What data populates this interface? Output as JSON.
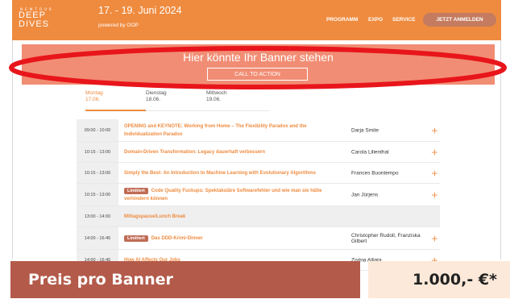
{
  "header": {
    "logo_small": "NEWTOUR",
    "logo_line1": "DEEP",
    "logo_line2": "DIVES",
    "dates": "17. - 19. Juni 2024",
    "powered": "powered by OOP",
    "nav": [
      "PROGRAMM",
      "EXPO",
      "SERVICE"
    ],
    "cta": "JETZT ANMELDEN"
  },
  "banner": {
    "title": "Hier könnte Ihr Banner stehen",
    "button": "CALL TO ACTION"
  },
  "tabs": [
    {
      "day": "Montag",
      "date": "17.06."
    },
    {
      "day": "Dienstag",
      "date": "18.06."
    },
    {
      "day": "Mittwoch",
      "date": "19.06."
    }
  ],
  "schedule": [
    {
      "time": "09:00 - 10:00",
      "badge": "",
      "title": "OPENING and KEYNOTE: Working from Home – The Flexibility Paradox and the Individualization Paradox",
      "speaker": "Darja Smite"
    },
    {
      "time": "10:15 - 13:00",
      "badge": "",
      "title": "Domain-Driven Transformation: Legacy dauerhaft verbessern",
      "speaker": "Carola Lilienthal"
    },
    {
      "time": "10:15 - 13:00",
      "badge": "",
      "title": "Simply the Best: An Introduction to Machine Learning with Evolutionary Algorithms",
      "speaker": "Frances Buontempo"
    },
    {
      "time": "10:15 - 13:00",
      "badge": "Limitiert",
      "title": "Code Quality Fuckups: Spektakuläre Softwarefehler und wie man sie hätte verhindern können",
      "speaker": "Jan Jürjens"
    },
    {
      "time": "13:00 - 14:00",
      "badge": "",
      "title": "Mittagspause/Lunch Break",
      "speaker": ""
    },
    {
      "time": "14:00 - 16:45",
      "badge": "Limitiert",
      "title": "Das DDD-Krimi-Dinner",
      "speaker": "Christopher Rudoll, Franziska Gilbert"
    },
    {
      "time": "14:00 - 16:45",
      "badge": "",
      "title": "How AI Affects Our Jobs",
      "speaker": "Zorina Alliata"
    }
  ],
  "price": {
    "label": "Preis pro Banner",
    "value": "1.000,- €*"
  },
  "colors": {
    "brand_orange": "#ef8b3f",
    "banner_salmon": "#f18d74",
    "highlight_red": "#e8151b",
    "price_dark": "#b35a4a",
    "price_light": "#fde9d9"
  }
}
